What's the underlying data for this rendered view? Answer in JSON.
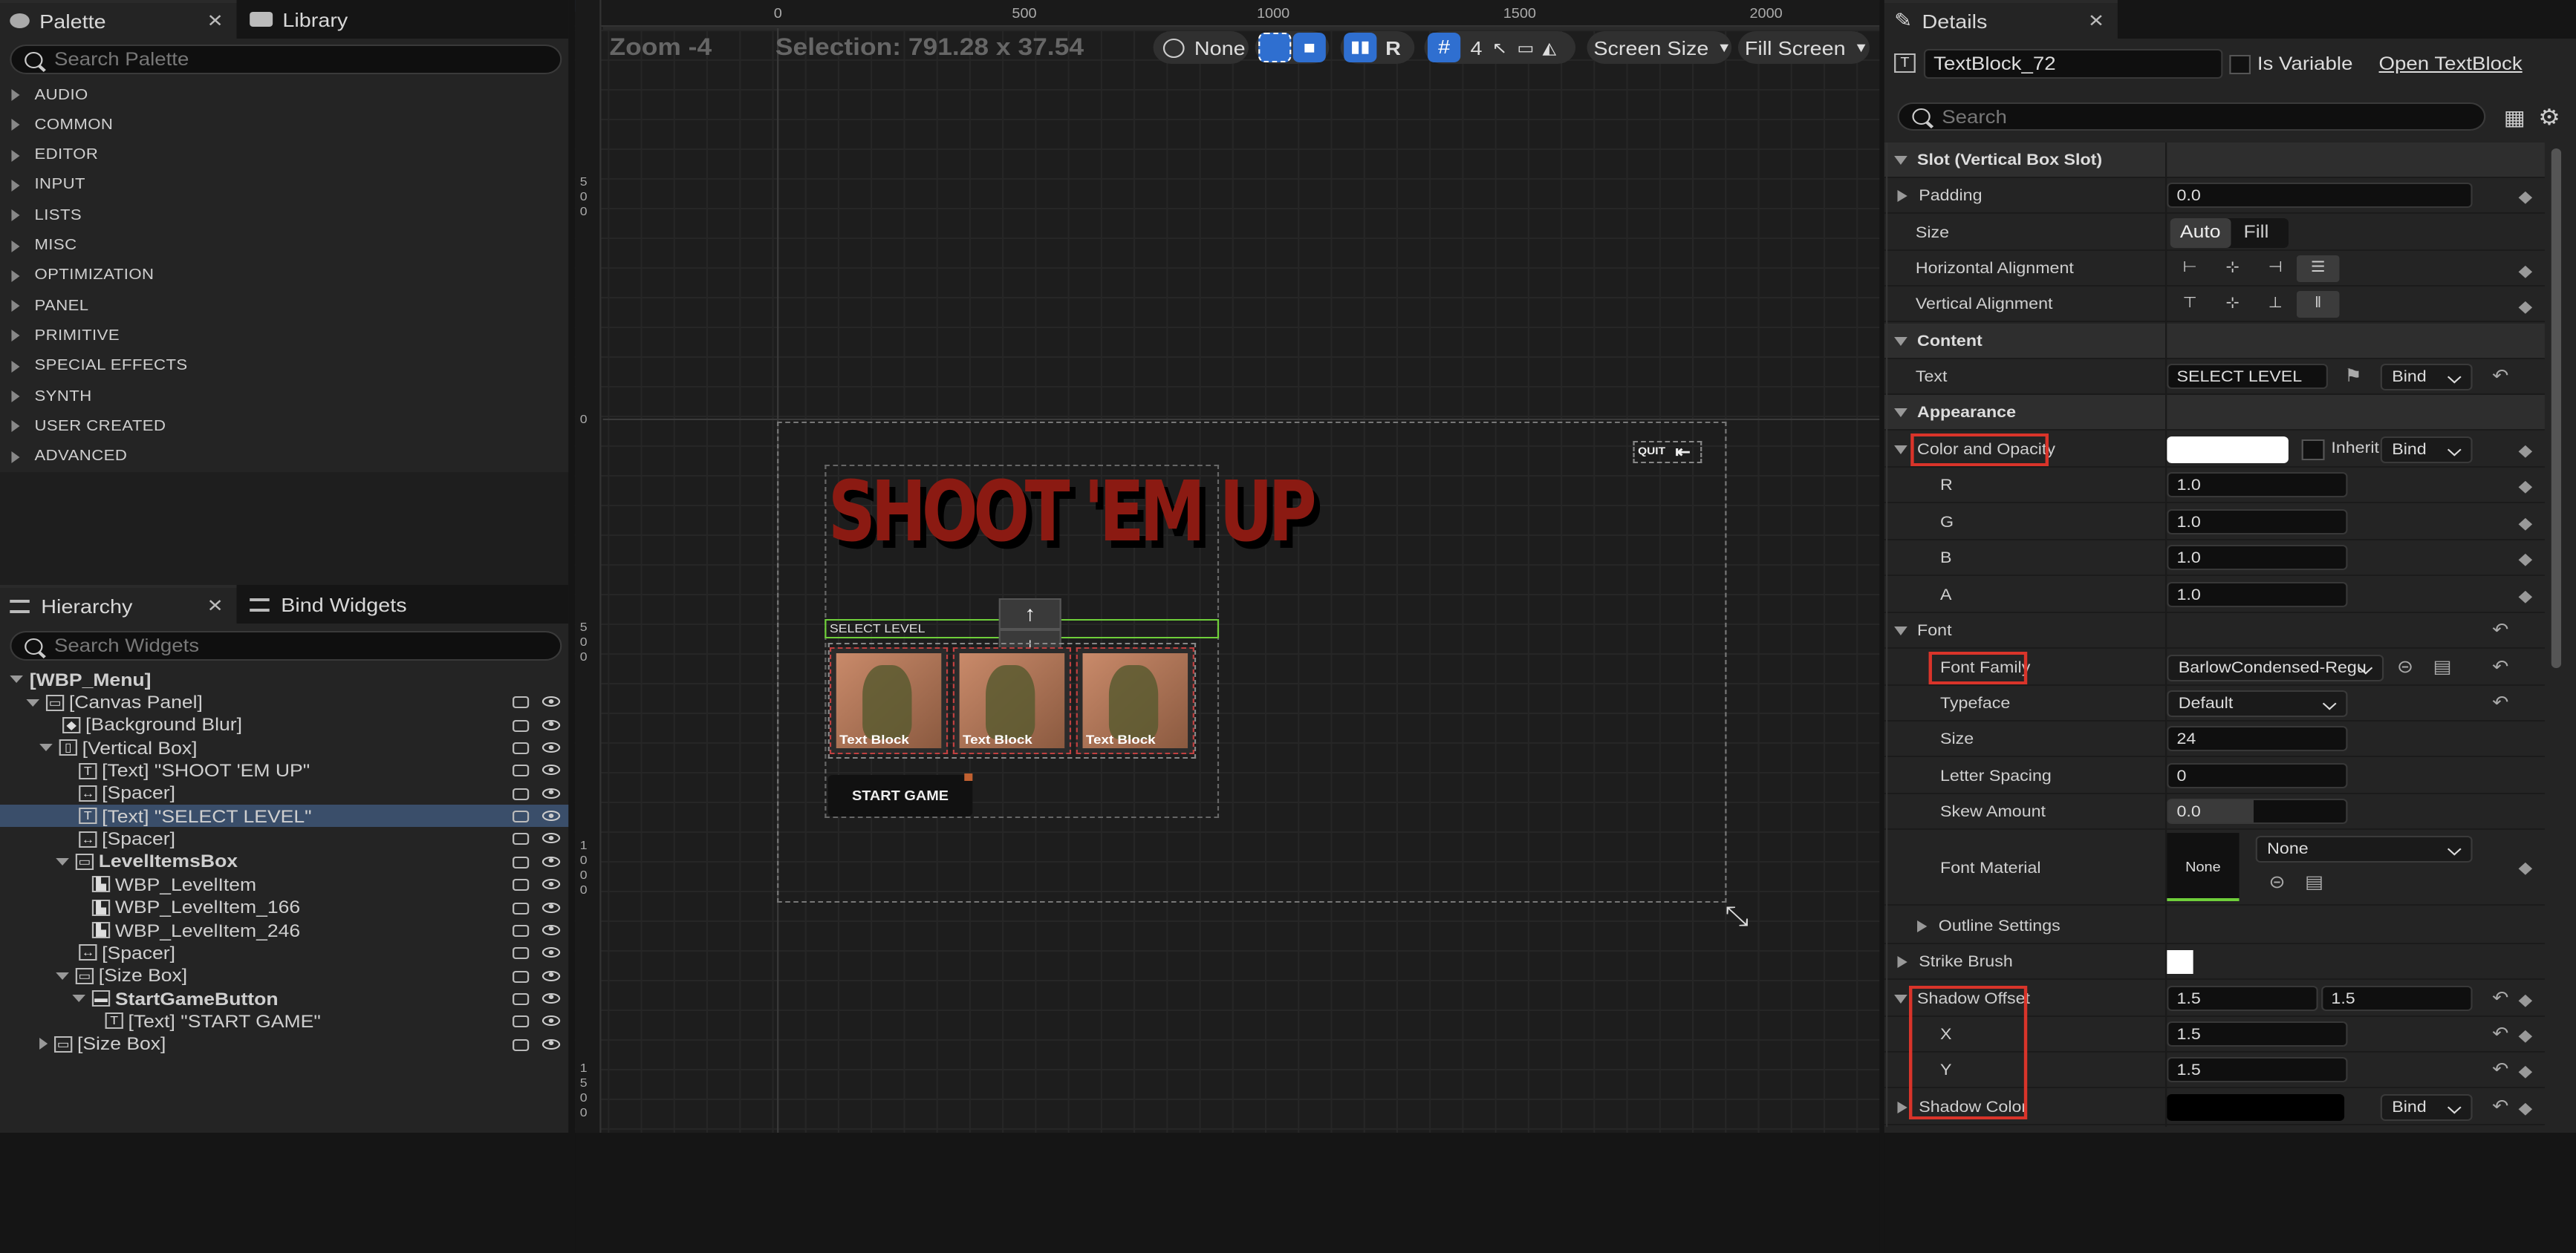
{
  "palette": {
    "tab_label": "Palette",
    "library_tab_label": "Library",
    "search_placeholder": "Search Palette",
    "categories": [
      "AUDIO",
      "COMMON",
      "EDITOR",
      "INPUT",
      "LISTS",
      "MISC",
      "OPTIMIZATION",
      "PANEL",
      "PRIMITIVE",
      "SPECIAL EFFECTS",
      "SYNTH",
      "USER CREATED",
      "ADVANCED"
    ]
  },
  "hierarchy": {
    "tab_label": "Hierarchy",
    "bind_tab_label": "Bind Widgets",
    "search_placeholder": "Search Widgets",
    "items": [
      {
        "label": "[WBP_Menu]"
      },
      {
        "label": "[Canvas Panel]"
      },
      {
        "label": "[Background Blur]"
      },
      {
        "label": "[Vertical Box]"
      },
      {
        "label": "[Text] \"SHOOT 'EM UP\""
      },
      {
        "label": "[Spacer]"
      },
      {
        "label": "[Text] \"SELECT LEVEL\""
      },
      {
        "label": "[Spacer]"
      },
      {
        "label": "LevelItemsBox"
      },
      {
        "label": "WBP_LevelItem"
      },
      {
        "label": "WBP_LevelItem_166"
      },
      {
        "label": "WBP_LevelItem_246"
      },
      {
        "label": "[Spacer]"
      },
      {
        "label": "[Size Box]"
      },
      {
        "label": "StartGameButton"
      },
      {
        "label": "[Text] \"START GAME\""
      },
      {
        "label": "[Size Box]"
      }
    ]
  },
  "viewport": {
    "zoom": "Zoom -4",
    "selection": "Selection: 791.28 x 37.54",
    "world_label": "None",
    "r_label": "R",
    "grid_value": "4",
    "screen_size": "Screen Size",
    "fill_screen": "Fill Screen",
    "ruler_top": [
      "0",
      "500",
      "1000",
      "1500",
      "2000"
    ],
    "ruler_left": [
      "500",
      "0",
      "500",
      "1000",
      "1500"
    ],
    "canvas": {
      "title": "SHOOT 'EM UP",
      "select_level": "SELECT LEVEL",
      "level_items": [
        "Text Block",
        "Text Block",
        "Text Block"
      ],
      "start_button": "START GAME",
      "quit_label": "QUIT"
    }
  },
  "details": {
    "tab_label": "Details",
    "widget_name": "TextBlock_72",
    "is_variable_label": "Is Variable",
    "open_link": "Open TextBlock",
    "search_placeholder": "Search",
    "sections": {
      "slot": "Slot (Vertical Box Slot)",
      "content": "Content",
      "appearance": "Appearance"
    },
    "padding_label": "Padding",
    "padding_value": "0.0",
    "size_label": "Size",
    "size_auto": "Auto",
    "size_fill": "Fill",
    "halign_label": "Horizontal Alignment",
    "valign_label": "Vertical Alignment",
    "text_label": "Text",
    "text_value": "SELECT LEVEL",
    "bind_label": "Bind",
    "color_label": "Color and Opacity",
    "inherit_label": "Inherit",
    "r_label": "R",
    "r_value": "1.0",
    "g_label": "G",
    "g_value": "1.0",
    "b_label": "B",
    "b_value": "1.0",
    "a_label": "A",
    "a_value": "1.0",
    "font_label": "Font",
    "font_family_label": "Font Family",
    "font_family_value": "BarlowCondensed-Regu",
    "typeface_label": "Typeface",
    "typeface_value": "Default",
    "size2_label": "Size",
    "size2_value": "24",
    "letter_spacing_label": "Letter Spacing",
    "letter_spacing_value": "0",
    "skew_label": "Skew Amount",
    "skew_value": "0.0",
    "font_material_label": "Font Material",
    "font_material_thumb": "None",
    "font_material_value": "None",
    "outline_label": "Outline Settings",
    "strike_label": "Strike Brush",
    "shadow_offset_label": "Shadow Offset",
    "shadow_offset_x": "1.5",
    "shadow_offset_y": "1.5",
    "x_label": "X",
    "x_value": "1.5",
    "y_label": "Y",
    "y_value": "1.5",
    "shadow_color_label": "Shadow Color"
  },
  "colors": {
    "accent": "#2f6fd0",
    "highlight": "#d9342a",
    "title_red": "#8b1a12",
    "select_green": "#6fcf3a"
  }
}
